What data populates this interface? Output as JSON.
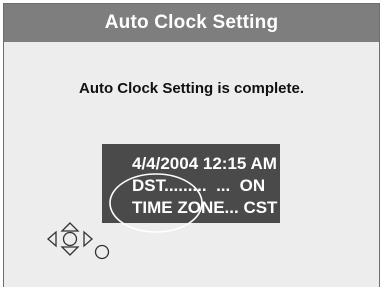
{
  "dialog": {
    "title": "Auto Clock Setting",
    "message": "Auto Clock Setting is complete."
  },
  "info": {
    "datetime": "4/4/2004 12:15 AM",
    "dst_line": "DST.........  ...  ON",
    "timezone_line": "TIME ZONE... CST"
  },
  "controls": {
    "icon": "dpad-navigation-icon",
    "select_icon": "enter-circle-icon"
  },
  "colors": {
    "title_bar": "#7e7e7e",
    "background": "#ededed",
    "info_box": "#4a4a4a"
  }
}
